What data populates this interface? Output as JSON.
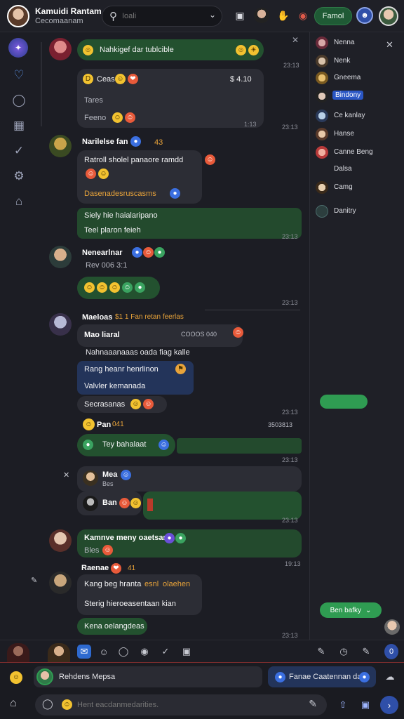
{
  "header": {
    "title": "Kamuidi Rantam",
    "subtitle": "Cecomaanam",
    "search_placeholder": "Ioali",
    "friend_button": "Famol"
  },
  "chat": {
    "msg1": {
      "text": "Nahkigef dar tublcible",
      "time1": "23:13"
    },
    "card1": {
      "line1": "Ceas",
      "amount": "$ 4.10",
      "line2": "Tares",
      "line3": "Feeno",
      "time": "1:13"
    },
    "time_a": "23:13",
    "msg2": {
      "name": "Narilelse fan",
      "meta": "43",
      "text1": "Ratroll sholel panaore ramdd",
      "text2": "Dasenadesruscasms",
      "bar1": "Siely hie haialaripano",
      "bar2": "Teel plaron feieh",
      "time": "23:13"
    },
    "msg3": {
      "name": "Nenearlnar",
      "sub": "Rev 006 3:1",
      "time": "23:13"
    },
    "msg4": {
      "name": "Maeloas",
      "header_right": "$1 1 Fan retan feerlas",
      "subname": "Mao liaral",
      "meta": "COOOS 040",
      "line1": "Nahnaaanaaas oada fiag kalle",
      "line2": "Rang heanr henrlinon",
      "line3": "Valvler kemanada",
      "line4": "Secrasanas",
      "time": "23:13"
    },
    "msg5": {
      "name": "Pan",
      "meta": "041",
      "right": "3503813",
      "pill": "Tey bahalaat",
      "time": "23:13"
    },
    "msg6": {
      "name": "Mea",
      "sub": "Bes",
      "time2": "23:13"
    },
    "msg7": {
      "name": "Ban",
      "time": "23:13"
    },
    "msg8": {
      "name": "Kamnve meny oaetsarn",
      "sub": "Bles",
      "time": "19:13"
    },
    "msg9": {
      "name": "Raenae",
      "meta": "41",
      "line1": "Kang beg hranta",
      "orange1": "esnl",
      "orange2": "olaehen",
      "line2": "Sterig hieroeasentaan kian",
      "pill": "Kena oelangdeas",
      "time": "23:13"
    }
  },
  "panel": {
    "members": [
      {
        "name": "Nenna"
      },
      {
        "name": "Nenk"
      },
      {
        "name": "Gneema"
      },
      {
        "name": "Bindony"
      },
      {
        "name": "Ce kanlay"
      },
      {
        "name": "Hanse"
      },
      {
        "name": "Canne Beng"
      },
      {
        "name": "Dalsa"
      },
      {
        "name": "Camg"
      },
      {
        "name": "Danitry"
      }
    ],
    "pill_button": "Ben bafky"
  },
  "reply": {
    "label": "Rehdens Mepsa",
    "chip": "Fanae Caatennan das."
  },
  "composer": {
    "placeholder": "Hent eacdanmedarities."
  },
  "colors": {
    "accent_green": "#2f9c52",
    "bubble_green": "#23512f",
    "navy": "#23345a",
    "background": "#1c1d24"
  }
}
